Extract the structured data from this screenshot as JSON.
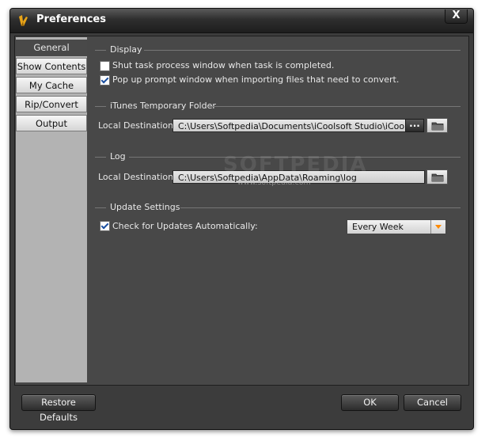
{
  "window": {
    "title": "Preferences",
    "close_label": "X"
  },
  "nav": {
    "items": [
      {
        "label": "General",
        "active": true
      },
      {
        "label": "Show Contents"
      },
      {
        "label": "My Cache"
      },
      {
        "label": "Rip/Convert"
      },
      {
        "label": "Output"
      }
    ]
  },
  "display": {
    "title": "Display",
    "options": [
      {
        "label": "Shut task process window when task is completed.",
        "checked": false
      },
      {
        "label": "Pop up prompt window when importing files that need to convert.",
        "checked": true
      }
    ]
  },
  "itunes": {
    "title": "iTunes Temporary Folder",
    "dest_label": "Local Destination:",
    "path": "C:\\Users\\Softpedia\\Documents\\iCoolsoft Studio\\iCoolsoft iP",
    "more_label": "..."
  },
  "log": {
    "title": "Log",
    "dest_label": "Local Destination:",
    "path": "C:\\Users\\Softpedia\\AppData\\Roaming\\log"
  },
  "update": {
    "title": "Update Settings",
    "check_label": "Check for Updates Automatically:",
    "checked": true,
    "frequency": "Every Week"
  },
  "watermark": {
    "big": "SOFTPEDIA",
    "small": "www.softpedia.com"
  },
  "footer": {
    "restore_label": "Restore Defaults",
    "ok_label": "OK",
    "cancel_label": "Cancel"
  },
  "colors": {
    "accent": "#ff8a00",
    "panel": "#484848",
    "nav": "#b3b3b3"
  }
}
